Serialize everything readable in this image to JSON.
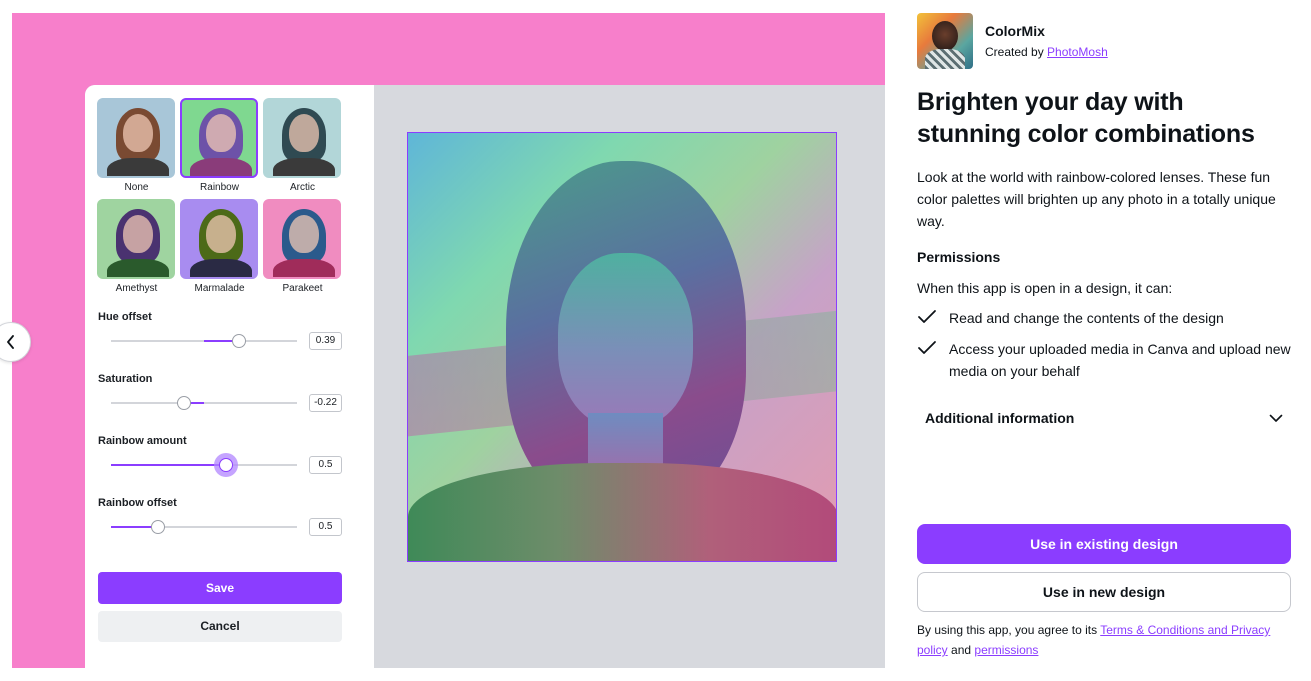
{
  "preview": {
    "filters": [
      {
        "label": "None",
        "selected": false,
        "hair": "#7a4a32",
        "bg": "#a8c6d8",
        "body": "#3a3a3a"
      },
      {
        "label": "Rainbow",
        "selected": true,
        "hair": "#6d52a8",
        "bg": "#7fd890",
        "body": "#8a3c7a"
      },
      {
        "label": "Arctic",
        "selected": false,
        "hair": "#2f4a52",
        "bg": "#b2d6d8",
        "body": "#3a3a3a"
      },
      {
        "label": "Amethyst",
        "selected": false,
        "hair": "#4a3270",
        "bg": "#9fd4a0",
        "body": "#2a5a2c"
      },
      {
        "label": "Marmalade",
        "selected": false,
        "hair": "#4c6a18",
        "bg": "#a88cf0",
        "body": "#2a2a44"
      },
      {
        "label": "Parakeet",
        "selected": false,
        "hair": "#2b5a8c",
        "bg": "#f08cc0",
        "body": "#a02c5a"
      }
    ],
    "controls": [
      {
        "label": "Hue offset",
        "value": "0.39",
        "level": 0.69,
        "fill_from": 0.5,
        "active": false
      },
      {
        "label": "Saturation",
        "value": "-0.22",
        "level": 0.39,
        "fill_from": 0.5,
        "active": false
      },
      {
        "label": "Rainbow amount",
        "value": "0.5",
        "level": 0.62,
        "fill_from": 0.0,
        "active": true
      },
      {
        "label": "Rainbow offset",
        "value": "0.5",
        "level": 0.25,
        "fill_from": 0.0,
        "active": false
      }
    ],
    "save_label": "Save",
    "cancel_label": "Cancel"
  },
  "info": {
    "app_name": "ColorMix",
    "created_by_prefix": "Created by",
    "creator": "PhotoMosh",
    "headline": "Brighten your day with stunning color combinations",
    "description": "Look at the world with rainbow-colored lenses. These fun color palettes will brighten up any photo in a totally unique way.",
    "permissions_title": "Permissions",
    "permissions_intro": "When this app is open in a design, it can:",
    "permissions": [
      "Read and change the contents of the design",
      "Access your uploaded media in Canva and upload new media on your behalf"
    ],
    "additional_info": "Additional information",
    "use_existing": "Use in existing design",
    "use_new": "Use in new design",
    "legal_prefix": "By using this app, you agree to its",
    "terms_link": "Terms & Conditions and Privacy policy",
    "legal_and": "and",
    "permissions_link": "permissions"
  },
  "colors": {
    "accent": "#8b3dff",
    "preview_bg": "#f77fcb"
  }
}
